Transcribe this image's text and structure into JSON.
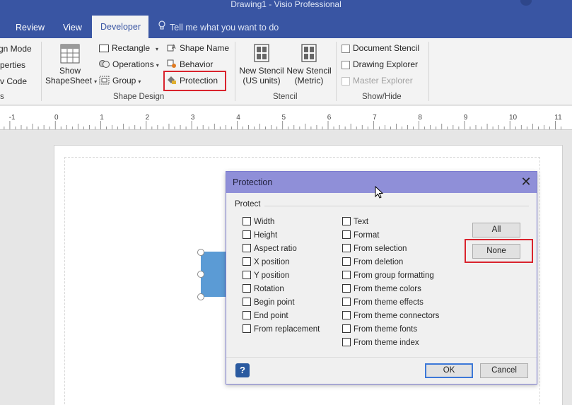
{
  "window": {
    "title": "Drawing1 - Visio Professional"
  },
  "tabs": [
    {
      "label": "Review",
      "active": false
    },
    {
      "label": "View",
      "active": false
    },
    {
      "label": "Developer",
      "active": true
    }
  ],
  "tell_me": {
    "label": "Tell me what you want to do",
    "icon": "lightbulb-icon"
  },
  "ribbon": {
    "code_group": {
      "items": [
        "gn Mode",
        "perties",
        "v Code"
      ],
      "label": "s"
    },
    "shape_design": {
      "show_shapesheet": {
        "line1": "Show",
        "line2": "ShapeSheet"
      },
      "rectangle": "Rectangle",
      "operations": "Operations",
      "group": "Group",
      "shape_name": "Shape Name",
      "behavior": "Behavior",
      "protection": "Protection",
      "label": "Shape Design"
    },
    "stencil": {
      "new_us": {
        "line1": "New Stencil",
        "line2": "(US units)"
      },
      "new_metric": {
        "line1": "New Stencil",
        "line2": "(Metric)"
      },
      "label": "Stencil"
    },
    "show_hide": {
      "document_stencil": "Document Stencil",
      "drawing_explorer": "Drawing Explorer",
      "master_explorer": "Master Explorer",
      "label": "Show/Hide"
    }
  },
  "ruler": {
    "labels": [
      "-1",
      "0",
      "1",
      "2",
      "3",
      "4",
      "5",
      "6",
      "7",
      "8",
      "9",
      "10",
      "11"
    ]
  },
  "dialog": {
    "title": "Protection",
    "group_label": "Protect",
    "left_options": [
      {
        "label": "Width",
        "checked": false
      },
      {
        "label": "Height",
        "checked": false
      },
      {
        "label": "Aspect ratio",
        "checked": false
      },
      {
        "label": "X position",
        "checked": false
      },
      {
        "label": "Y position",
        "checked": false
      },
      {
        "label": "Rotation",
        "checked": false
      },
      {
        "label": "Begin point",
        "checked": false
      },
      {
        "label": "End point",
        "checked": false
      },
      {
        "label": "From replacement",
        "checked": false
      }
    ],
    "right_options": [
      {
        "label": "Text",
        "checked": false
      },
      {
        "label": "Format",
        "checked": false
      },
      {
        "label": "From selection",
        "checked": false
      },
      {
        "label": "From deletion",
        "checked": false
      },
      {
        "label": "From group formatting",
        "checked": false
      },
      {
        "label": "From theme colors",
        "checked": false
      },
      {
        "label": "From theme effects",
        "checked": false
      },
      {
        "label": "From theme connectors",
        "checked": false
      },
      {
        "label": "From theme fonts",
        "checked": false
      },
      {
        "label": "From theme index",
        "checked": false
      }
    ],
    "all_button": "All",
    "none_button": "None",
    "ok_button": "OK",
    "cancel_button": "Cancel",
    "help_icon": "?"
  },
  "colors": {
    "title_bar": "#3955a3",
    "dialog_title": "#8f8fd8",
    "highlight": "#d9232d",
    "shape_fill": "#5b9bd5"
  }
}
